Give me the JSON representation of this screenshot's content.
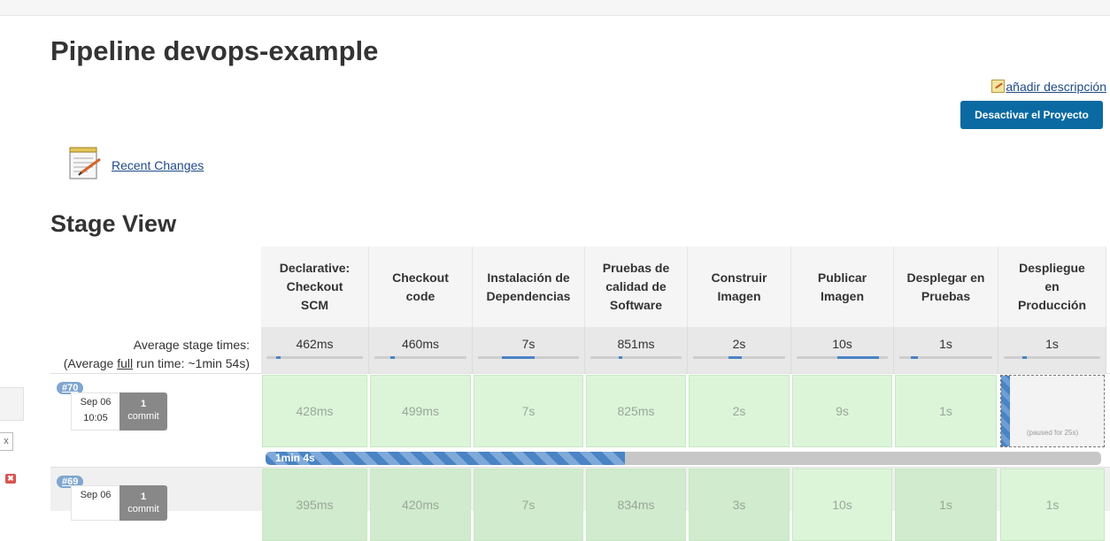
{
  "page": {
    "title": "Pipeline devops-example",
    "add_description": "añadir descripción",
    "disable_button": "Desactivar el Proyecto",
    "recent_changes": "Recent Changes",
    "stage_view_title": "Stage View"
  },
  "left_panel": {
    "close_glyph": "x",
    "error_glyph": "✖"
  },
  "average": {
    "label": "Average stage times:",
    "full_prefix": "(Average ",
    "full_link": "full",
    "full_suffix": " run time: ~1min 54s)"
  },
  "stages": [
    {
      "lines": [
        "Declarative:",
        "Checkout",
        "SCM"
      ],
      "avg": "462ms",
      "avg_bar": 0.05
    },
    {
      "lines": [
        "Checkout",
        "code"
      ],
      "avg": "460ms",
      "avg_bar": 0.05
    },
    {
      "lines": [
        "Instalación de",
        "Dependencias"
      ],
      "avg": "7s",
      "avg_bar": 0.32
    },
    {
      "lines": [
        "Pruebas de",
        "calidad de",
        "Software"
      ],
      "avg": "851ms",
      "avg_bar": 0.04
    },
    {
      "lines": [
        "Construir",
        "Imagen"
      ],
      "avg": "2s",
      "avg_bar": 0.15
    },
    {
      "lines": [
        "Publicar",
        "Imagen"
      ],
      "avg": "10s",
      "avg_bar": 0.45
    },
    {
      "lines": [
        "Desplegar en",
        "Pruebas"
      ],
      "avg": "1s",
      "avg_bar": 0.08
    },
    {
      "lines": [
        "Despliegue",
        "en",
        "Producción"
      ],
      "avg": "1s",
      "avg_bar": 0.05
    }
  ],
  "runs": [
    {
      "badge": "#70",
      "date": "Sep 06",
      "time": "10:05",
      "commit_count": "1",
      "commit_label": "commit",
      "durations": [
        "428ms",
        "499ms",
        "7s",
        "825ms",
        "2s",
        "9s",
        "1s"
      ],
      "paused_text": "(paused for 25s)",
      "progress_label": "1min 4s",
      "progress_fraction": 0.43
    },
    {
      "badge": "#69",
      "date": "Sep 06",
      "time": "",
      "commit_count": "1",
      "commit_label": "commit",
      "durations": [
        "395ms",
        "420ms",
        "7s",
        "834ms",
        "3s",
        "10s",
        "1s",
        "1s"
      ]
    }
  ]
}
